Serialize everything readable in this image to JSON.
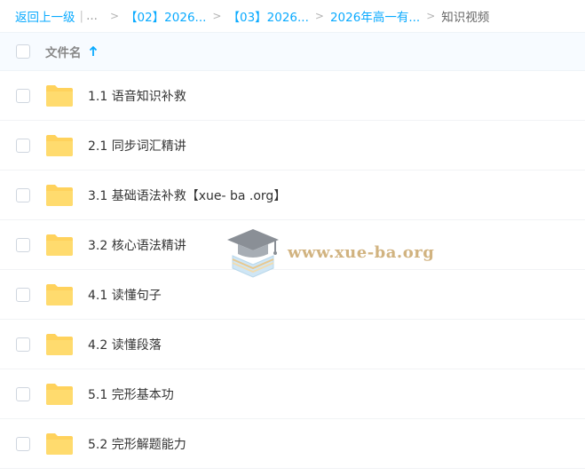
{
  "breadcrumb": {
    "back": "返回上一级",
    "sep": "|",
    "ellipsis": "...",
    "items": [
      "【02】2026...",
      "【03】2026...",
      "2026年高一有..."
    ],
    "current": "知识视频"
  },
  "header": {
    "column_name": "文件名",
    "sort": "ascending"
  },
  "files": [
    {
      "name": "1.1 语音知识补救",
      "type": "folder"
    },
    {
      "name": "2.1 同步词汇精讲",
      "type": "folder"
    },
    {
      "name": "3.1 基础语法补救【xue- ba .org】",
      "type": "folder"
    },
    {
      "name": "3.2 核心语法精讲",
      "type": "folder"
    },
    {
      "name": "4.1 读懂句子",
      "type": "folder"
    },
    {
      "name": "4.2 读懂段落",
      "type": "folder"
    },
    {
      "name": "5.1 完形基本功",
      "type": "folder"
    },
    {
      "name": "5.2 完形解题能力",
      "type": "folder"
    }
  ],
  "watermark": {
    "text": "www.xue-ba.org"
  },
  "colors": {
    "link": "#09AAFF",
    "folder": "#FFD25C",
    "header_bg": "#F7FBFF"
  }
}
